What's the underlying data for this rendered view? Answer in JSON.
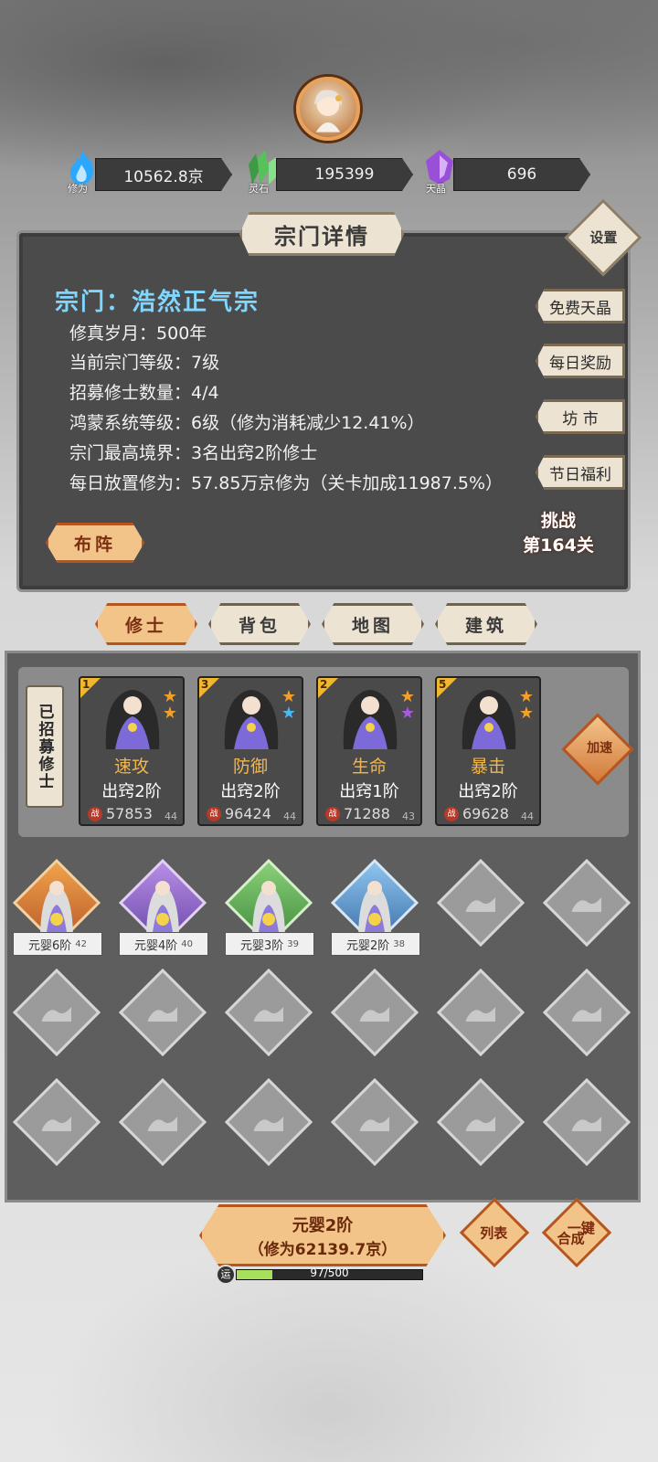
{
  "resources": [
    {
      "name": "修为",
      "value": "10562.8京",
      "color": "#2aa7ff",
      "icon": "flame-icon"
    },
    {
      "name": "灵石",
      "value": "195399",
      "color": "#57c25a",
      "icon": "crystal-icon"
    },
    {
      "name": "天晶",
      "value": "696",
      "color": "#9a4fd8",
      "icon": "gem-icon"
    }
  ],
  "panel": {
    "title": "宗门详情",
    "settings": "设置",
    "sect_name": "宗门：浩然正气宗",
    "rows": [
      {
        "label": "修真岁月：",
        "value": "500年"
      },
      {
        "label": "当前宗门等级：",
        "value": "7级"
      },
      {
        "label": "招募修士数量：",
        "value": "4/4"
      },
      {
        "label": "鸿蒙系统等级：",
        "value": "6级（修为消耗减少12.41%）"
      },
      {
        "label": "宗门最高境界：",
        "value": "3名出窍2阶修士"
      },
      {
        "label": "每日放置修为：",
        "value": "57.85万京修为（关卡加成11987.5%）"
      }
    ],
    "side_buttons": [
      "免费天晶",
      "每日奖励",
      "坊 市",
      "节日福利"
    ],
    "formation": "布阵",
    "challenge_line1": "挑战",
    "challenge_line2": "第164关"
  },
  "tabs": [
    {
      "label": "修士",
      "active": true
    },
    {
      "label": "背包",
      "active": false
    },
    {
      "label": "地图",
      "active": false
    },
    {
      "label": "建筑",
      "active": false
    }
  ],
  "recruited": {
    "label": "已招募修士",
    "speedup": "加速",
    "cards": [
      {
        "rank": "1",
        "role": "速攻",
        "realm": "出窍2阶",
        "power": "57853",
        "level": "44",
        "stars": [
          "#f2a02a",
          "#f2a02a"
        ]
      },
      {
        "rank": "3",
        "role": "防御",
        "realm": "出窍2阶",
        "power": "96424",
        "level": "44",
        "stars": [
          "#f2a02a",
          "#4ab8f2"
        ]
      },
      {
        "rank": "2",
        "role": "生命",
        "realm": "出窍1阶",
        "power": "71288",
        "level": "43",
        "stars": [
          "#f2a02a",
          "#a85ae0"
        ]
      },
      {
        "rank": "5",
        "role": "暴击",
        "realm": "出窍2阶",
        "power": "69628",
        "level": "44",
        "stars": [
          "#f2a02a",
          "#f2a02a"
        ]
      }
    ]
  },
  "grid_cells": [
    {
      "color": "orange",
      "label": "元婴6阶",
      "level": "42"
    },
    {
      "color": "purple",
      "label": "元婴4阶",
      "level": "40"
    },
    {
      "color": "green",
      "label": "元婴3阶",
      "level": "39"
    },
    {
      "color": "blue",
      "label": "元婴2阶",
      "level": "38"
    }
  ],
  "bottom": {
    "merge_line1": "元婴2阶",
    "merge_line2": "（修为62139.7京）",
    "list": "列表",
    "auto_merge_1": "一键",
    "auto_merge_2": "合成",
    "luck_icon": "运",
    "luck_text": "97/500",
    "luck_fraction": 0.194
  }
}
